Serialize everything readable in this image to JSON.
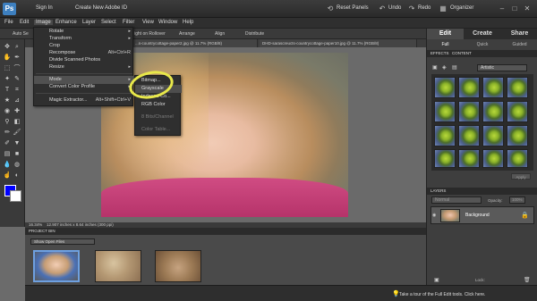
{
  "top_bar": {
    "logo": "Ps",
    "sign_in": "Sign In",
    "create_id": "Create New Adobe ID",
    "reset_panels": "Reset Panels",
    "undo": "Undo",
    "redo": "Redo",
    "organizer": "Organizer"
  },
  "menubar": [
    "File",
    "Edit",
    "Image",
    "Enhance",
    "Layer",
    "Select",
    "Filter",
    "View",
    "Window",
    "Help"
  ],
  "options_bar": {
    "auto_select": "Auto Se",
    "show_highlight": "ight on Rollover",
    "arrange": "Arrange",
    "align": "Align",
    "distribute": "Distribute"
  },
  "doc_tabs": [
    "...s-countrycottage-paper2.jpg @ 11.7% (RGB/8)",
    "DHD-sarascreucts-countrycottage-paper10.jpg @ 11.7% (RGB/8)"
  ],
  "image_menu": {
    "items": [
      {
        "label": "Rotate",
        "shortcut": "",
        "submenu": true
      },
      {
        "label": "Transform",
        "shortcut": "",
        "submenu": true
      },
      {
        "label": "Crop",
        "shortcut": ""
      },
      {
        "label": "Recompose",
        "shortcut": "Alt+Ctrl+R"
      },
      {
        "label": "Divide Scanned Photos",
        "shortcut": ""
      },
      {
        "label": "Resize",
        "shortcut": "",
        "submenu": true
      },
      {
        "label": "Mode",
        "shortcut": "",
        "submenu": true
      },
      {
        "label": "Convert Color Profile",
        "shortcut": "",
        "submenu": true
      },
      {
        "label": "Magic Extractor...",
        "shortcut": "Alt+Shift+Ctrl+V"
      }
    ]
  },
  "mode_menu": {
    "items": [
      "Bitmap...",
      "Grayscale",
      "Indexed Co...",
      "RGB Color",
      "8 Bits/Channel",
      "Color Table..."
    ]
  },
  "status_bar": {
    "zoom": "16.34%",
    "info": "12.907 inches x 8.64 inches (300 ppi)"
  },
  "right_panel": {
    "tabs": [
      "Edit",
      "Create",
      "Share"
    ],
    "subtabs": [
      "Full",
      "Quick",
      "Guided"
    ],
    "effects_header": "EFFECTS",
    "content_header": "CONTENT",
    "effects_filter": "Artistic",
    "apply": "Apply",
    "layers_header": "LAYERS",
    "blend_mode": "Normal",
    "opacity_label": "Opacity:",
    "opacity_value": "100%",
    "lock_label": "Lock:",
    "layer_name": "Background"
  },
  "project_bin": {
    "header": "PROJECT BIN",
    "selector": "Show Open Files"
  },
  "footer": {
    "tip": "Take a tour of the Full Edit tools. Click here."
  },
  "colors": {
    "foreground": "#0000ff",
    "background": "#ffffff",
    "highlight_circle": "#e8e84a"
  }
}
